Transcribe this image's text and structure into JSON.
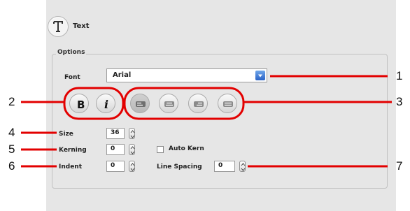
{
  "panel": {
    "title": "Text",
    "title_icon": "text-tool-icon"
  },
  "options": {
    "legend": "Options",
    "font": {
      "label": "Font",
      "value": "Arial"
    },
    "style_buttons": [
      {
        "name": "bold",
        "glyph": "B"
      },
      {
        "name": "italic",
        "glyph": "i"
      }
    ],
    "alignment_buttons": [
      "align-left",
      "align-center",
      "align-right",
      "justify"
    ],
    "size": {
      "label": "Size",
      "value": "36"
    },
    "kerning": {
      "label": "Kerning",
      "value": "0"
    },
    "auto_kern": {
      "label": "Auto Kern",
      "checked": false
    },
    "indent": {
      "label": "Indent",
      "value": "0"
    },
    "line_spacing": {
      "label": "Line Spacing",
      "value": "0"
    }
  },
  "callouts": [
    "1",
    "2",
    "3",
    "4",
    "5",
    "6",
    "7"
  ],
  "colors": {
    "annotation": "#e30000",
    "panel_bg": "#e6e6e6",
    "select_button": "#2a63c6"
  }
}
